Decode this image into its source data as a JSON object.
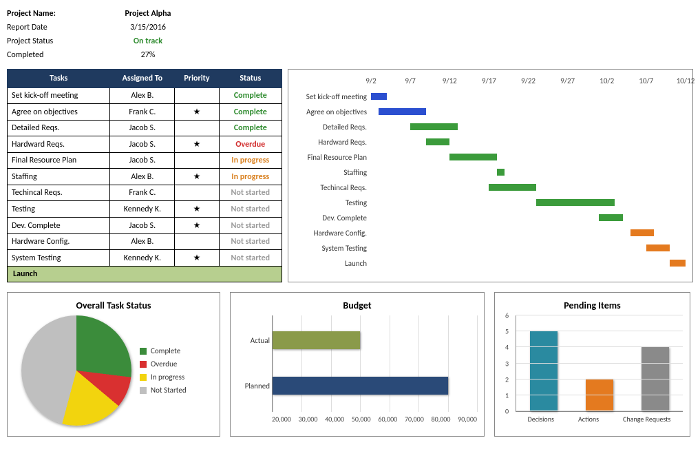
{
  "meta": {
    "project_name_label": "Project Name:",
    "project_name": "Project Alpha",
    "report_date_label": "Report Date",
    "report_date": "3/15/2016",
    "status_label": "Project Status",
    "status": "On track",
    "completed_label": "Completed",
    "completed": "27%"
  },
  "task_table": {
    "headers": {
      "task": "Tasks",
      "assigned": "Assigned To",
      "priority": "Priority",
      "status": "Status"
    },
    "rows": [
      {
        "task": "Set kick-off meeting",
        "assigned": "Alex B.",
        "priority": false,
        "status": "Complete"
      },
      {
        "task": "Agree on objectives",
        "assigned": "Frank C.",
        "priority": true,
        "status": "Complete"
      },
      {
        "task": "Detailed Reqs.",
        "assigned": "Jacob S.",
        "priority": false,
        "status": "Complete"
      },
      {
        "task": "Hardward Reqs.",
        "assigned": "Jacob S.",
        "priority": true,
        "status": "Overdue"
      },
      {
        "task": "Final Resource Plan",
        "assigned": "Jacob S.",
        "priority": false,
        "status": "In progress"
      },
      {
        "task": "Staffing",
        "assigned": "Alex B.",
        "priority": true,
        "status": "In progress"
      },
      {
        "task": "Techincal Reqs.",
        "assigned": "Frank C.",
        "priority": false,
        "status": "Not started"
      },
      {
        "task": "Testing",
        "assigned": "Kennedy K.",
        "priority": true,
        "status": "Not started"
      },
      {
        "task": "Dev. Complete",
        "assigned": "Jacob S.",
        "priority": true,
        "status": "Not started"
      },
      {
        "task": "Hardware Config.",
        "assigned": "Alex B.",
        "priority": false,
        "status": "Not started"
      },
      {
        "task": "System Testing",
        "assigned": "Kennedy K.",
        "priority": true,
        "status": "Not started"
      }
    ],
    "launch_label": "Launch"
  },
  "gantt": {
    "ticks": [
      "9/2",
      "9/7",
      "9/12",
      "9/17",
      "9/22",
      "9/27",
      "10/2",
      "10/7",
      "10/12"
    ],
    "rows": [
      {
        "label": "Set kick-off meeting",
        "start": 0,
        "len": 2,
        "color": "blue"
      },
      {
        "label": "Agree on objectives",
        "start": 1,
        "len": 6,
        "color": "blue"
      },
      {
        "label": "Detailed Reqs.",
        "start": 5,
        "len": 6,
        "color": "green"
      },
      {
        "label": "Hardward Reqs.",
        "start": 7,
        "len": 3,
        "color": "green"
      },
      {
        "label": "Final Resource Plan",
        "start": 10,
        "len": 6,
        "color": "green"
      },
      {
        "label": "Staffing",
        "start": 16,
        "len": 1,
        "color": "green"
      },
      {
        "label": "Techincal Reqs.",
        "start": 15,
        "len": 6,
        "color": "green"
      },
      {
        "label": "Testing",
        "start": 21,
        "len": 10,
        "color": "green"
      },
      {
        "label": "Dev. Complete",
        "start": 29,
        "len": 3,
        "color": "green"
      },
      {
        "label": "Hardware Config.",
        "start": 33,
        "len": 3,
        "color": "orange"
      },
      {
        "label": "System Testing",
        "start": 35,
        "len": 3,
        "color": "orange"
      },
      {
        "label": "Launch",
        "start": 38,
        "len": 2,
        "color": "orange"
      }
    ],
    "range_days": 40
  },
  "chart_data": [
    {
      "type": "pie",
      "title": "Overall Task Status",
      "categories": [
        "Complete",
        "Overdue",
        "In progress",
        "Not Started"
      ],
      "values": [
        3,
        1,
        2,
        5
      ],
      "colors": [
        "#3b8c3b",
        "#d93030",
        "#f2d40e",
        "#bfbfbf"
      ]
    },
    {
      "type": "bar",
      "orientation": "horizontal",
      "title": "Budget",
      "categories": [
        "Actual",
        "Planned"
      ],
      "values": [
        50000,
        80000
      ],
      "xlabel": "",
      "ylabel": "",
      "xlim": [
        20000,
        90000
      ],
      "xticks": [
        20000,
        30000,
        40000,
        50000,
        60000,
        70000,
        80000,
        90000
      ],
      "colors": [
        "#8a9a4a",
        "#2a4a78"
      ]
    },
    {
      "type": "bar",
      "orientation": "vertical",
      "title": "Pending Items",
      "categories": [
        "Decisions",
        "Actions",
        "Change Requests"
      ],
      "values": [
        5,
        2,
        4
      ],
      "ylim": [
        0,
        6
      ],
      "yticks": [
        0,
        1,
        2,
        3,
        4,
        5,
        6
      ],
      "colors": [
        "#2a8aa0",
        "#e47a1f",
        "#8a8a8a"
      ]
    }
  ]
}
